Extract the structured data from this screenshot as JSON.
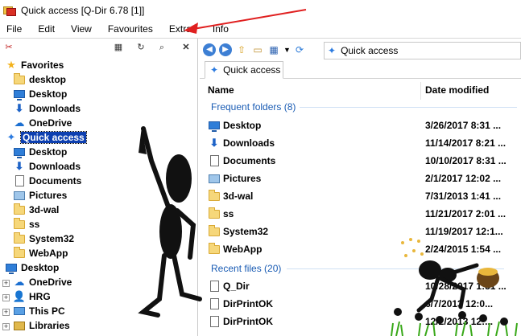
{
  "window": {
    "title": "Quick access  [Q-Dir 6.78 [1]]"
  },
  "menu": [
    {
      "label": "File"
    },
    {
      "label": "Edit"
    },
    {
      "label": "View"
    },
    {
      "label": "Favourites"
    },
    {
      "label": "Extras"
    },
    {
      "label": "Info"
    }
  ],
  "tree": {
    "favorites": "Favorites",
    "fav_items": [
      "desktop",
      "Desktop",
      "Downloads",
      "OneDrive"
    ],
    "quick_access": "Quick access",
    "qa_items": [
      "Desktop",
      "Downloads",
      "Documents",
      "Pictures",
      "3d-wal",
      "ss",
      "System32",
      "WebApp"
    ],
    "roots": [
      "Desktop",
      "OneDrive",
      "HRG",
      "This PC",
      "Libraries"
    ]
  },
  "address": {
    "path": "Quick access"
  },
  "tab": {
    "label": "Quick access"
  },
  "columns": {
    "name": "Name",
    "date": "Date modified"
  },
  "groups": {
    "frequent": "Frequent folders (8)",
    "recent": "Recent files (20)"
  },
  "frequent_folders": [
    {
      "name": "Desktop",
      "date": "3/26/2017 8:31 ...",
      "icon": "desktop-icon"
    },
    {
      "name": "Downloads",
      "date": "11/14/2017 8:21 ...",
      "icon": "downloads-icon"
    },
    {
      "name": "Documents",
      "date": "10/10/2017 8:31 ...",
      "icon": "documents-icon"
    },
    {
      "name": "Pictures",
      "date": "2/1/2017 12:02 ...",
      "icon": "pictures-icon"
    },
    {
      "name": "3d-wal",
      "date": "7/31/2013 1:41 ...",
      "icon": "folder-icon"
    },
    {
      "name": "ss",
      "date": "11/21/2017 2:01 ...",
      "icon": "folder-icon"
    },
    {
      "name": "System32",
      "date": "11/19/2017 12:1...",
      "icon": "folder-icon"
    },
    {
      "name": "WebApp",
      "date": "2/24/2015 1:54 ...",
      "icon": "folder-icon"
    }
  ],
  "recent_files": [
    {
      "name": "Q_Dir",
      "date": "10/28/2017 1:31 ..."
    },
    {
      "name": "DirPrintOK",
      "date": "6/7/2013 12:0..."
    },
    {
      "name": "DirPrintOK",
      "date": "12/2/2013 12:..."
    }
  ],
  "colors": {
    "accent": "#0d3fb0",
    "group_text": "#1a5cb4",
    "arrow": "#e02020"
  }
}
